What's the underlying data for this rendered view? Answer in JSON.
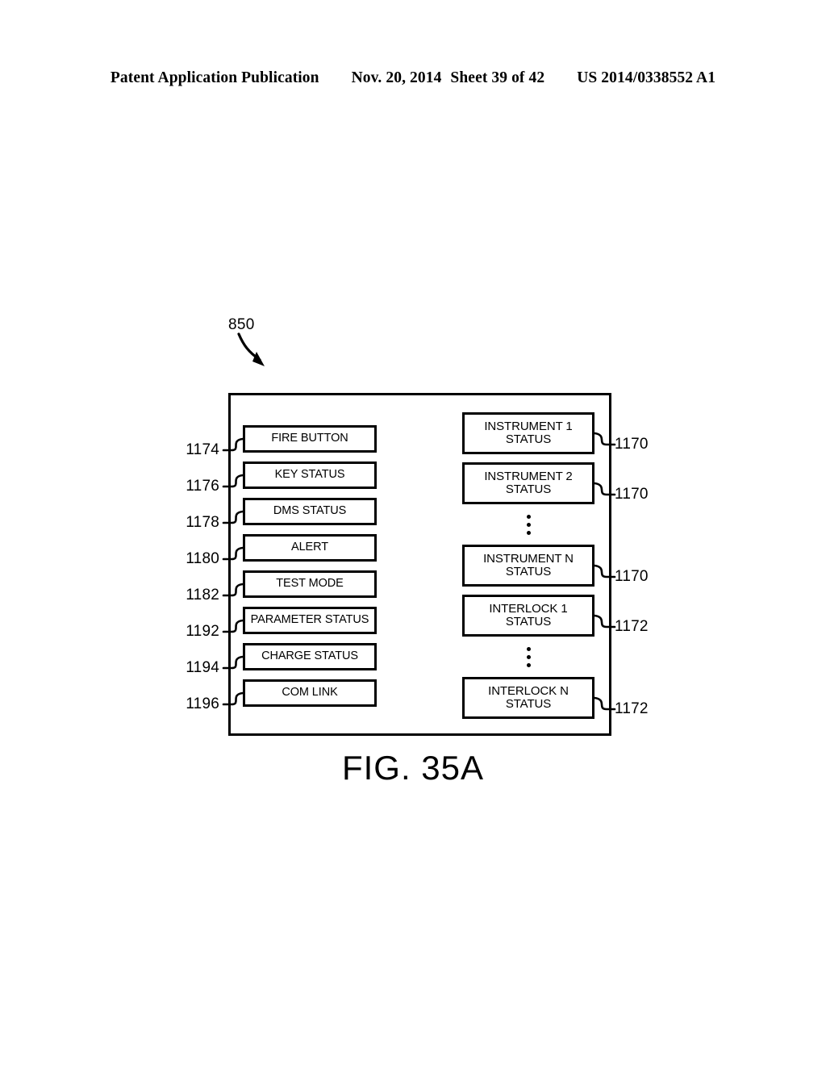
{
  "header": {
    "publication": "Patent Application Publication",
    "date": "Nov. 20, 2014",
    "sheet": "Sheet 39 of 42",
    "patent_number": "US 2014/0338552 A1"
  },
  "figure": {
    "caption": "FIG. 35A",
    "assembly_ref": "850",
    "left_column": [
      {
        "label": "FIRE BUTTON",
        "ref": "1174"
      },
      {
        "label": "KEY STATUS",
        "ref": "1176"
      },
      {
        "label": "DMS STATUS",
        "ref": "1178"
      },
      {
        "label": "ALERT",
        "ref": "1180"
      },
      {
        "label": "TEST MODE",
        "ref": "1182"
      },
      {
        "label": "PARAMETER STATUS",
        "ref": "1192"
      },
      {
        "label": "CHARGE STATUS",
        "ref": "1194"
      },
      {
        "label": "COM LINK",
        "ref": "1196"
      }
    ],
    "right_column": [
      {
        "line1": "INSTRUMENT 1",
        "line2": "STATUS",
        "ref": "1170",
        "ellipsis_after": false
      },
      {
        "line1": "INSTRUMENT 2",
        "line2": "STATUS",
        "ref": "1170",
        "ellipsis_after": true
      },
      {
        "line1": "INSTRUMENT N",
        "line2": "STATUS",
        "ref": "1170",
        "ellipsis_after": false
      },
      {
        "line1": "INTERLOCK 1",
        "line2": "STATUS",
        "ref": "1172",
        "ellipsis_after": true
      },
      {
        "line1": "INTERLOCK N",
        "line2": "STATUS",
        "ref": "1172",
        "ellipsis_after": false
      }
    ]
  }
}
